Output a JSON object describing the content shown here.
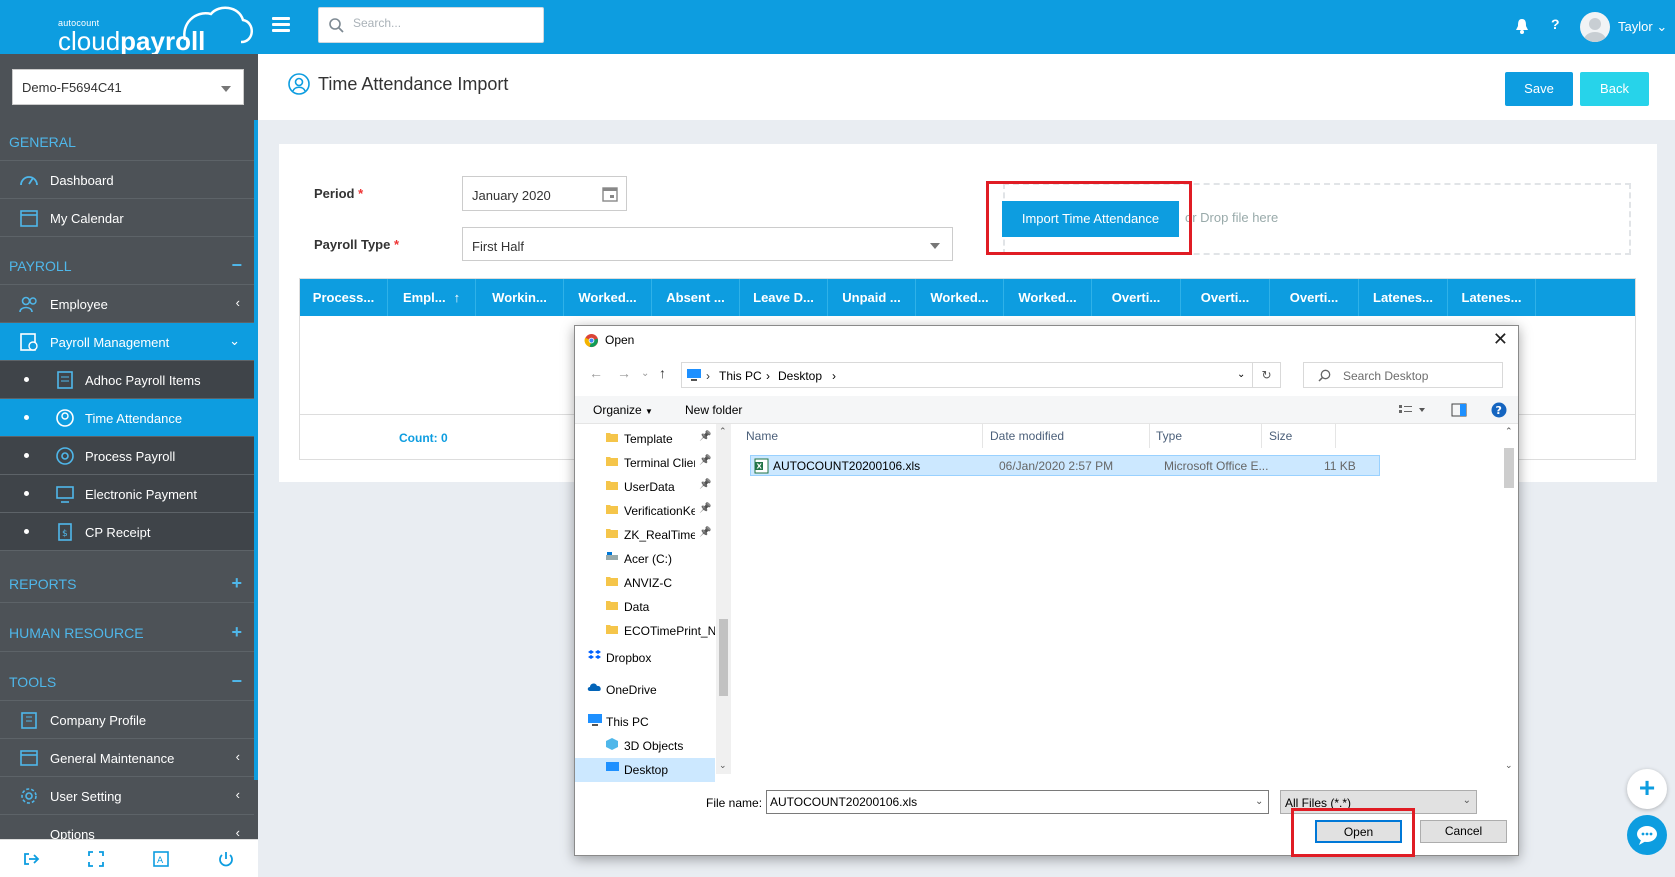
{
  "app": {
    "logo_small": "autocount",
    "logo_main": "cloud",
    "logo_bold": "payroll",
    "search_placeholder": "Search...",
    "username": "Taylor"
  },
  "sidebar": {
    "company": "Demo-F5694C41",
    "sections": {
      "general": "GENERAL",
      "payroll": "PAYROLL",
      "reports": "REPORTS",
      "human_resource": "HUMAN RESOURCE",
      "tools": "TOOLS"
    },
    "items": {
      "dashboard": "Dashboard",
      "calendar": "My Calendar",
      "employee": "Employee",
      "payroll_mgmt": "Payroll Management",
      "adhoc": "Adhoc Payroll Items",
      "time_attendance": "Time Attendance",
      "process_payroll": "Process Payroll",
      "epayment": "Electronic Payment",
      "cp_receipt": "CP Receipt",
      "company_profile": "Company Profile",
      "general_maint": "General Maintenance",
      "user_setting": "User Setting",
      "options": "Options"
    }
  },
  "page": {
    "title": "Time Attendance Import",
    "save": "Save",
    "back": "Back",
    "period_label": "Period",
    "period_value": "January 2020",
    "ptype_label": "Payroll Type",
    "ptype_value": "First Half",
    "import_button": "Import Time Attendance",
    "drop_text": "or Drop file here",
    "count": "Count: 0",
    "columns": [
      "Process...",
      "Empl...",
      "Workin...",
      "Worked...",
      "Absent ...",
      "Leave D...",
      "Unpaid ...",
      "Worked...",
      "Worked...",
      "Overti...",
      "Overti...",
      "Overti...",
      "Latenes...",
      "Latenes..."
    ]
  },
  "dialog": {
    "title": "Open",
    "path": [
      "This PC",
      "Desktop"
    ],
    "search_placeholder": "Search Desktop",
    "organize": "Organize",
    "new_folder": "New folder",
    "nav_items": [
      "Template",
      "Terminal Client",
      "UserData",
      "VerificationKey",
      "ZK_RealTime_",
      "Acer (C:)",
      "ANVIZ-C",
      "Data",
      "ECOTimePrint_N",
      "Dropbox",
      "OneDrive",
      "This PC",
      "3D Objects",
      "Desktop"
    ],
    "columns": {
      "name": "Name",
      "date": "Date modified",
      "type": "Type",
      "size": "Size"
    },
    "file": {
      "name": "AUTOCOUNT20200106.xls",
      "date": "06/Jan/2020 2:57 PM",
      "type": "Microsoft Office E...",
      "size": "11 KB"
    },
    "filename_label": "File name:",
    "filename_value": "AUTOCOUNT20200106.xls",
    "filetype": "All Files (*.*)",
    "open": "Open",
    "cancel": "Cancel"
  }
}
